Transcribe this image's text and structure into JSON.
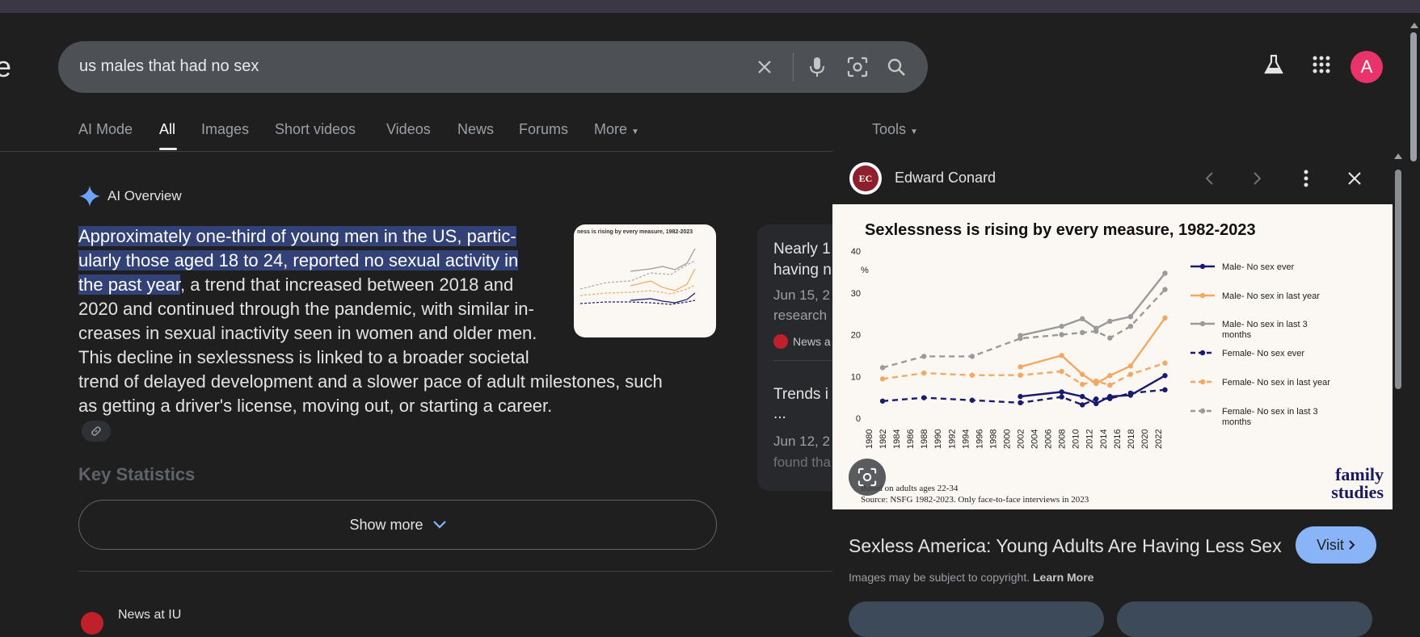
{
  "header": {
    "logo_fragment": "e",
    "search_query": "us males that had no sex",
    "avatar_letter": "A"
  },
  "tabs": [
    {
      "label": "AI Mode"
    },
    {
      "label": "All"
    },
    {
      "label": "Images"
    },
    {
      "label": "Short videos"
    },
    {
      "label": "Videos"
    },
    {
      "label": "News"
    },
    {
      "label": "Forums"
    },
    {
      "label": "More"
    }
  ],
  "tools_label": "Tools",
  "ai_overview": {
    "title": "AI Overview",
    "highlight_1": "Approximately one-third of young men in the US, partic-",
    "highlight_2": "ularly those aged 18 to 24, reported no sexual activity in",
    "highlight_3": "the past year",
    "text_3": ", a trend that increased between 2018 and",
    "text_4": "2020 and continued through the pandemic, with similar in-",
    "text_5": "creases in sexual inactivity seen in women and older men.",
    "text_6": "This decline in sexlessness is linked to a broader societal",
    "text_7": "trend of delayed development and a slower pace of adult milestones, such",
    "text_8": "as getting a driver's license, moving out, or starting a career.",
    "key_stats": "Key Statistics",
    "show_more": "Show more",
    "thumb_title": "ness is rising by every measure, 1982-2023"
  },
  "news_card": {
    "line1": "Nearly 1",
    "line2": "having n",
    "date1": "Jun 15, 2",
    "date1b": "research",
    "source1": "News a",
    "line3": "Trends i",
    "line3b": "...",
    "date2": "Jun 12, 2",
    "date2b": "found tha"
  },
  "bottom": {
    "news_label": "News at IU"
  },
  "panel": {
    "source_name": "Edward Conard",
    "source_logo": "EC",
    "title": "Sexless America: Young Adults Are Having Less Sex",
    "visit_label": "Visit",
    "copyright": "Images may be subject to copyright.",
    "learn_more": "Learn More"
  },
  "colors": {
    "highlight": "#324276",
    "visit": "#8ab4f8",
    "avatar": "#e8336b",
    "navy": "#1a1a6e",
    "orange": "#f5a862",
    "gray": "#9a9a9a"
  },
  "chart_data": {
    "type": "line",
    "title": "Sexlessness is rising by every measure, 1982-2023",
    "ylabel": "%",
    "ylim": [
      0,
      40
    ],
    "yticks": [
      0,
      10,
      20,
      30,
      40
    ],
    "xticks": [
      "1980",
      "1982",
      "1984",
      "1986",
      "1988",
      "1990",
      "1992",
      "1994",
      "1996",
      "1998",
      "2000",
      "2002",
      "2004",
      "2006",
      "2008",
      "2010",
      "2012",
      "2014",
      "2016",
      "2018",
      "2020",
      "2022"
    ],
    "xlim": [
      1980,
      2024
    ],
    "note": "Based on adults ages 22-34",
    "source": "Source: NSFG 1982-2023. Only face-to-face interviews in 2023",
    "brand_line1": "family",
    "brand_line2": "studies",
    "series": [
      {
        "name": "Male-  No sex ever",
        "dashed": false,
        "color": "#1a1a6e",
        "points": [
          [
            2002,
            5.2
          ],
          [
            2008,
            6.3
          ],
          [
            2011,
            5.2
          ],
          [
            2013,
            3.5
          ],
          [
            2015,
            5.2
          ],
          [
            2018,
            5.5
          ],
          [
            2023,
            10.2
          ]
        ]
      },
      {
        "name": "Male-  No sex in last year",
        "dashed": false,
        "color": "#f5a862",
        "points": [
          [
            2002,
            12.3
          ],
          [
            2008,
            15.0
          ],
          [
            2011,
            10.5
          ],
          [
            2013,
            8.3
          ],
          [
            2015,
            10.2
          ],
          [
            2018,
            12.5
          ],
          [
            2023,
            24.0
          ]
        ]
      },
      {
        "name": "Male-  No sex in last 3 months",
        "dashed": false,
        "color": "#9a9a9a",
        "points": [
          [
            2002,
            19.8
          ],
          [
            2008,
            22.0
          ],
          [
            2011,
            23.8
          ],
          [
            2013,
            21.5
          ],
          [
            2015,
            23.2
          ],
          [
            2018,
            24.3
          ],
          [
            2023,
            34.7
          ]
        ]
      },
      {
        "name": "Female-  No sex ever",
        "dashed": true,
        "color": "#1a1a6e",
        "points": [
          [
            1982,
            4.1
          ],
          [
            1988,
            4.9
          ],
          [
            1995,
            4.3
          ],
          [
            2002,
            3.7
          ],
          [
            2008,
            5.1
          ],
          [
            2011,
            3.2
          ],
          [
            2013,
            4.6
          ],
          [
            2015,
            4.7
          ],
          [
            2018,
            6.0
          ],
          [
            2023,
            6.8
          ]
        ]
      },
      {
        "name": "Female-  No sex in last year",
        "dashed": true,
        "color": "#f5a862",
        "points": [
          [
            1982,
            9.4
          ],
          [
            1988,
            10.8
          ],
          [
            1995,
            10.3
          ],
          [
            2002,
            10.3
          ],
          [
            2008,
            11.2
          ],
          [
            2011,
            8.1
          ],
          [
            2013,
            8.9
          ],
          [
            2015,
            7.9
          ],
          [
            2018,
            10.5
          ],
          [
            2023,
            13.2
          ]
        ]
      },
      {
        "name": "Female-  No sex in last 3 months",
        "dashed": true,
        "color": "#9a9a9a",
        "points": [
          [
            1982,
            12.1
          ],
          [
            1988,
            14.8
          ],
          [
            1995,
            14.8
          ],
          [
            2002,
            19.1
          ],
          [
            2008,
            20.0
          ],
          [
            2011,
            20.5
          ],
          [
            2013,
            20.8
          ],
          [
            2015,
            19.2
          ],
          [
            2018,
            22.0
          ],
          [
            2023,
            30.8
          ]
        ]
      }
    ]
  }
}
